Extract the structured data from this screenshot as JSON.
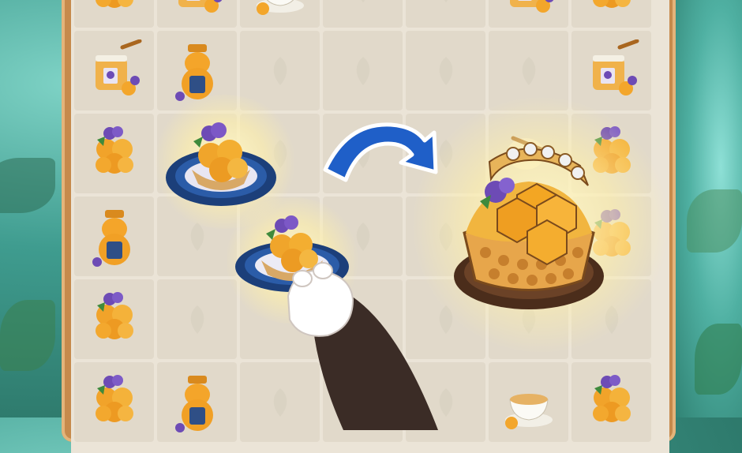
{
  "scene": {
    "board_accent": "#c68a4c",
    "cell_color": "#e1d9ca",
    "arrow_color": "#1f5fc8",
    "glow_color": "#fff4c0"
  },
  "items": {
    "top_row": [
      "honeycomb-drip-icon",
      "honey-jar-comb-icon",
      "tea-cup-icon",
      "empty",
      "honey-jar-berry-icon",
      "honeycomb-drip-icon"
    ],
    "row1": [
      "honey-pot-dipper-icon",
      "honey-bear-bottle-icon",
      "empty",
      "empty",
      "empty",
      "empty",
      "honey-pot-dipper-icon"
    ],
    "row2": [
      "berry-honeycomb-icon",
      "honey-tart-plate-icon",
      "empty",
      "empty",
      "empty",
      "honey-dipper-icon",
      "berry-honeycomb-icon"
    ],
    "row3": [
      "honey-bear-bottle-icon",
      "empty",
      "empty",
      "empty",
      "empty",
      "empty",
      "honeycomb-glow-icon"
    ],
    "row4": [
      "berry-honeycomb-icon",
      "empty",
      "honey-tart-plate-icon",
      "empty",
      "empty",
      "empty",
      "empty"
    ],
    "row5": [
      "berry-honeycomb-icon",
      "honey-bear-bottle-icon",
      "empty",
      "empty",
      "empty",
      "tea-cup-icon",
      "berry-honeycomb-icon"
    ]
  },
  "merge_result": "honey-basket-cake-icon"
}
